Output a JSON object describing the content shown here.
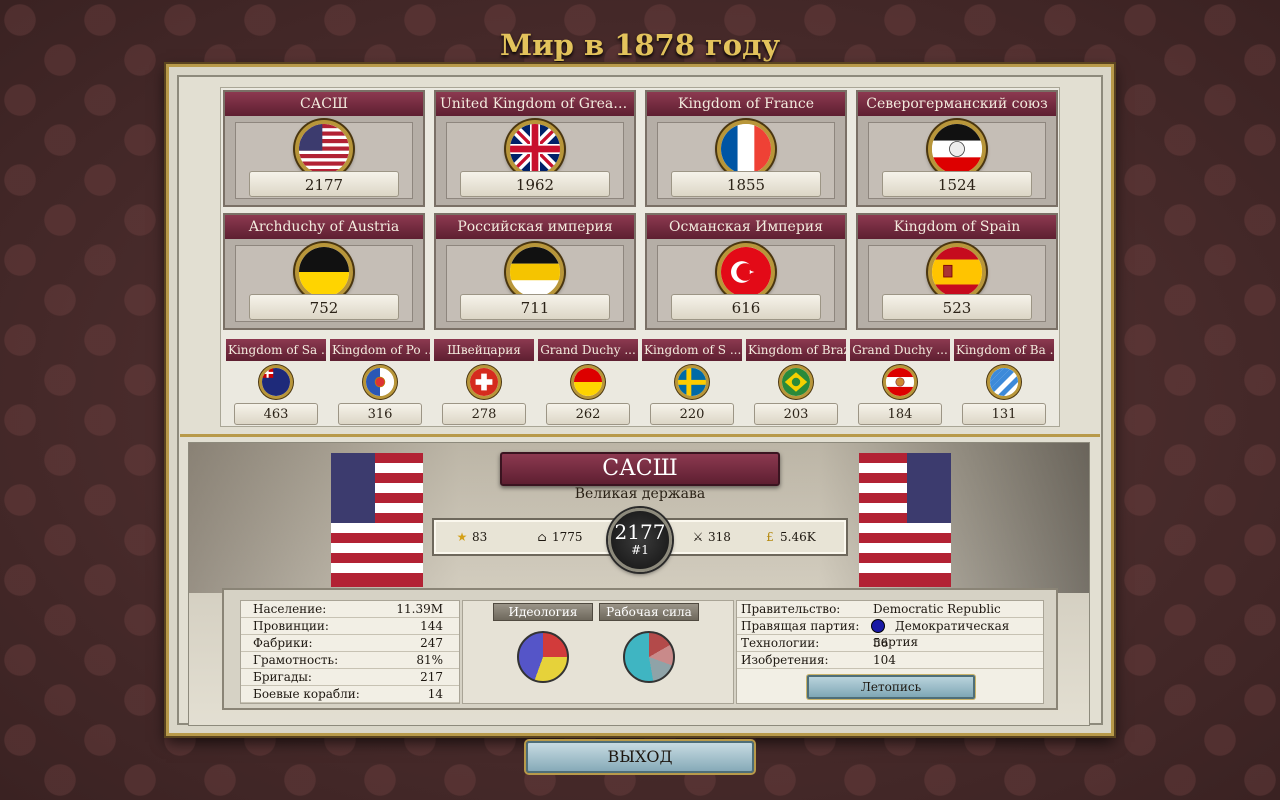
{
  "title": "Мир в 1878 году",
  "top_nations": [
    {
      "name": "САСШ",
      "score": "2177",
      "flag": "usa"
    },
    {
      "name": "United Kingdom of Great B ...",
      "score": "1962",
      "flag": "uk"
    },
    {
      "name": "Kingdom of France",
      "score": "1855",
      "flag": "france"
    },
    {
      "name": "Северогерманский союз",
      "score": "1524",
      "flag": "ngc"
    },
    {
      "name": "Archduchy of Austria",
      "score": "752",
      "flag": "austria"
    },
    {
      "name": "Российская империя",
      "score": "711",
      "flag": "russia"
    },
    {
      "name": "Османская Империя",
      "score": "616",
      "flag": "ottoman"
    },
    {
      "name": "Kingdom of Spain",
      "score": "523",
      "flag": "spain"
    }
  ],
  "secondary_nations": [
    {
      "name": "Kingdom of Sa ...",
      "score": "463",
      "flag": "sardinia"
    },
    {
      "name": "Kingdom of Po ...",
      "score": "316",
      "flag": "portugal"
    },
    {
      "name": "Швейцария",
      "score": "278",
      "flag": "swiss"
    },
    {
      "name": "Grand Duchy ...",
      "score": "262",
      "flag": "baden"
    },
    {
      "name": "Kingdom of S ...",
      "score": "220",
      "flag": "sweden"
    },
    {
      "name": "Kingdom of Brazil",
      "score": "203",
      "flag": "brazil"
    },
    {
      "name": "Grand Duchy ...",
      "score": "184",
      "flag": "tuscany"
    },
    {
      "name": "Kingdom of Ba ...",
      "score": "131",
      "flag": "bavaria"
    }
  ],
  "selected": {
    "name": "САСШ",
    "status": "Великая держава",
    "prestige": "83",
    "industry": "1775",
    "military": "318",
    "money": "5.46K",
    "score": "2177",
    "rank": "#1"
  },
  "stats_left": [
    {
      "label": "Население:",
      "value": "11.39M"
    },
    {
      "label": "Провинции:",
      "value": "144"
    },
    {
      "label": "Фабрики:",
      "value": "247"
    },
    {
      "label": "Грамотность:",
      "value": "81%"
    },
    {
      "label": "Бригады:",
      "value": "217"
    },
    {
      "label": "Боевые корабли:",
      "value": "14"
    }
  ],
  "tabs": {
    "ideology": "Идеология",
    "workforce": "Рабочая сила"
  },
  "stats_right": {
    "government_label": "Правительство:",
    "government": "Democratic Republic",
    "party_label": "Правящая партия:",
    "party": "Демократическая партия",
    "tech_label": "Технологии:",
    "tech": "56",
    "inventions_label": "Изобретения:",
    "inventions": "104"
  },
  "chronicle_button": "Летопись",
  "exit_button": "ВЫХОД",
  "colors": {
    "header": "#6e2940",
    "gold": "#b89a4a",
    "title": "#e3c35c"
  }
}
